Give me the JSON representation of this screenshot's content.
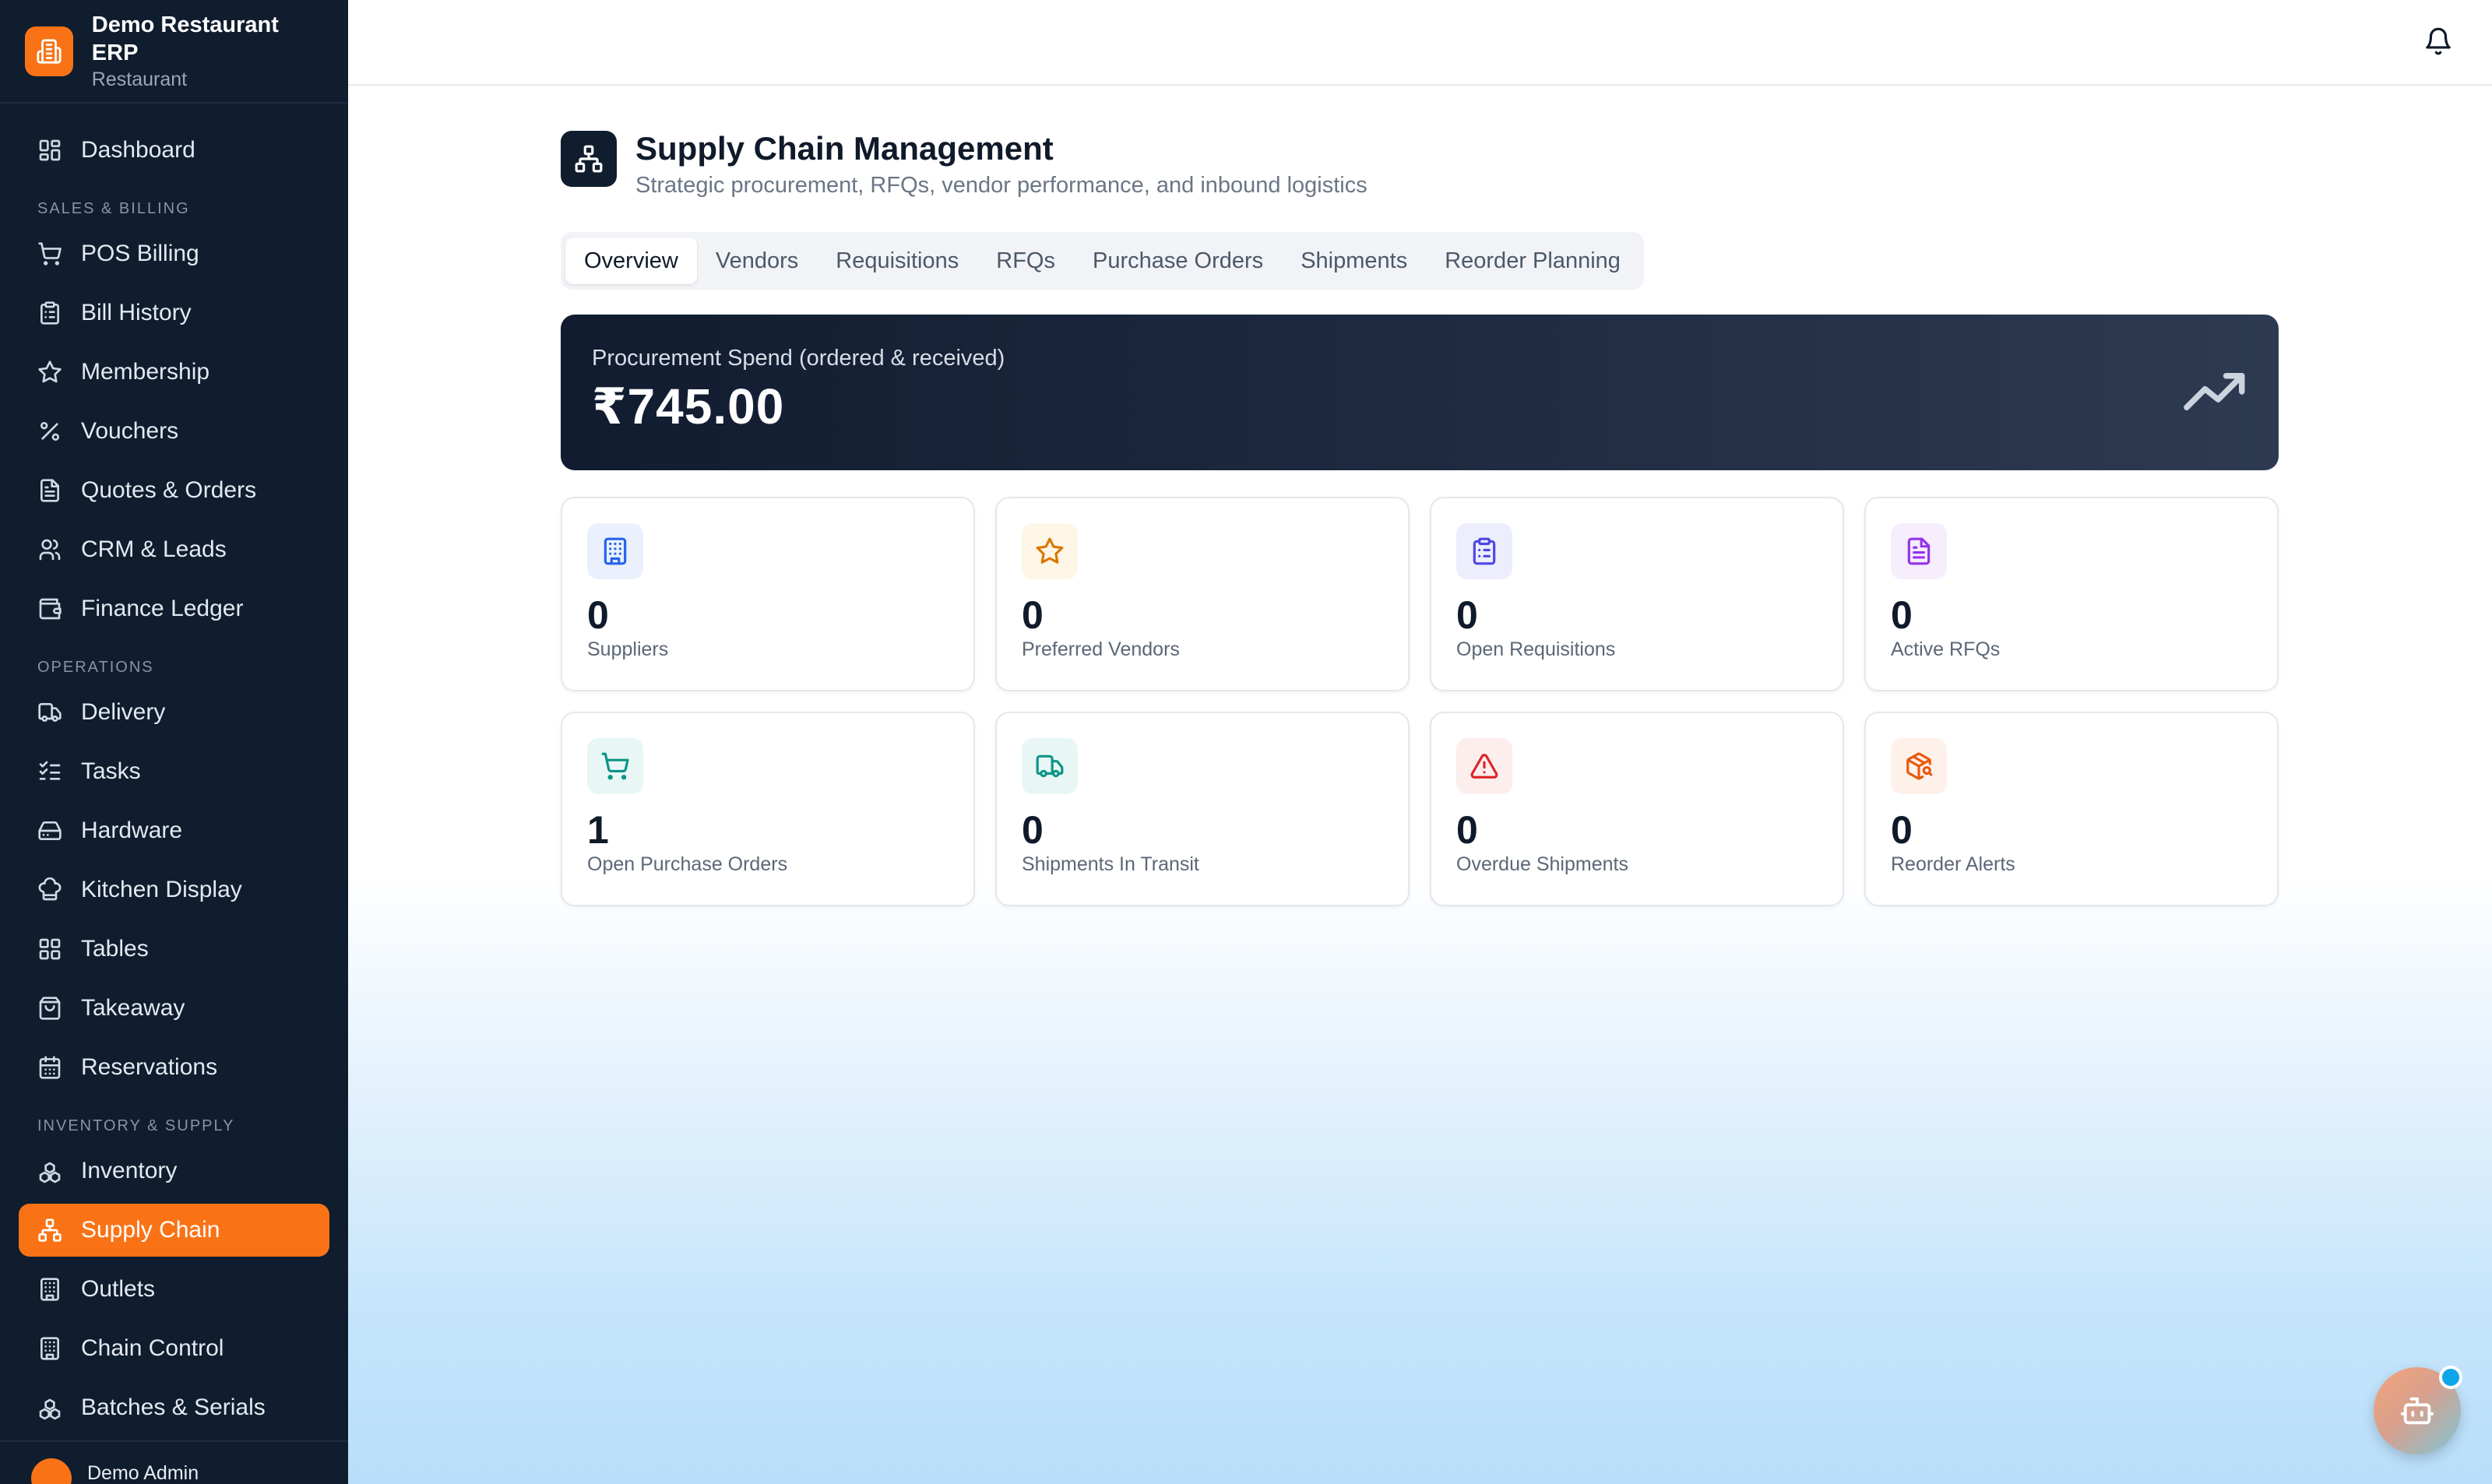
{
  "brand": {
    "name": "Demo Restaurant ERP",
    "type": "Restaurant",
    "color": "#f97316"
  },
  "sidebar": {
    "items": [
      {
        "label": "Dashboard",
        "icon": "dashboard-icon"
      },
      {
        "section": "SALES & BILLING"
      },
      {
        "label": "POS Billing",
        "icon": "cart-icon"
      },
      {
        "label": "Bill History",
        "icon": "clipboard-icon"
      },
      {
        "label": "Membership",
        "icon": "star-icon"
      },
      {
        "label": "Vouchers",
        "icon": "percent-icon"
      },
      {
        "label": "Quotes & Orders",
        "icon": "document-icon"
      },
      {
        "label": "CRM & Leads",
        "icon": "users-icon"
      },
      {
        "label": "Finance Ledger",
        "icon": "wallet-icon"
      },
      {
        "section": "OPERATIONS"
      },
      {
        "label": "Delivery",
        "icon": "truck-icon"
      },
      {
        "label": "Tasks",
        "icon": "checklist-icon"
      },
      {
        "label": "Hardware",
        "icon": "hard-drive-icon"
      },
      {
        "label": "Kitchen Display",
        "icon": "chef-hat-icon"
      },
      {
        "label": "Tables",
        "icon": "grid-icon"
      },
      {
        "label": "Takeaway",
        "icon": "bag-icon"
      },
      {
        "label": "Reservations",
        "icon": "calendar-icon"
      },
      {
        "section": "INVENTORY & SUPPLY"
      },
      {
        "label": "Inventory",
        "icon": "boxes-icon"
      },
      {
        "label": "Supply Chain",
        "icon": "network-icon",
        "active": true
      },
      {
        "label": "Outlets",
        "icon": "building-icon"
      },
      {
        "label": "Chain Control",
        "icon": "building-icon"
      },
      {
        "label": "Batches & Serials",
        "icon": "boxes-icon"
      }
    ],
    "footer": {
      "admin_name": "Demo Admin"
    }
  },
  "page": {
    "title": "Supply Chain Management",
    "subtitle": "Strategic procurement, RFQs, vendor performance, and inbound logistics"
  },
  "tabs": [
    {
      "label": "Overview",
      "active": true
    },
    {
      "label": "Vendors"
    },
    {
      "label": "Requisitions"
    },
    {
      "label": "RFQs"
    },
    {
      "label": "Purchase Orders"
    },
    {
      "label": "Shipments"
    },
    {
      "label": "Reorder Planning"
    }
  ],
  "spend": {
    "label": "Procurement Spend (ordered & received)",
    "value": "₹745.00"
  },
  "stats": [
    {
      "value": "0",
      "label": "Suppliers",
      "icon": "building-icon",
      "color": "#2563eb",
      "bg": "#eaf1fd"
    },
    {
      "value": "0",
      "label": "Preferred Vendors",
      "icon": "star-icon",
      "color": "#d97706",
      "bg": "#fdf6e7"
    },
    {
      "value": "0",
      "label": "Open Requisitions",
      "icon": "clipboard-icon",
      "color": "#4f46e5",
      "bg": "#eceefc"
    },
    {
      "value": "0",
      "label": "Active RFQs",
      "icon": "document-icon",
      "color": "#9333ea",
      "bg": "#f6edfd"
    },
    {
      "value": "1",
      "label": "Open Purchase Orders",
      "icon": "cart-icon",
      "color": "#0d9488",
      "bg": "#e8f7f5"
    },
    {
      "value": "0",
      "label": "Shipments In Transit",
      "icon": "truck-icon",
      "color": "#0d9488",
      "bg": "#e8f7f5"
    },
    {
      "value": "0",
      "label": "Overdue Shipments",
      "icon": "alert-icon",
      "color": "#dc2626",
      "bg": "#fdeeee"
    },
    {
      "value": "0",
      "label": "Reorder Alerts",
      "icon": "package-search-icon",
      "color": "#ea580c",
      "bg": "#fdf1ea"
    }
  ]
}
